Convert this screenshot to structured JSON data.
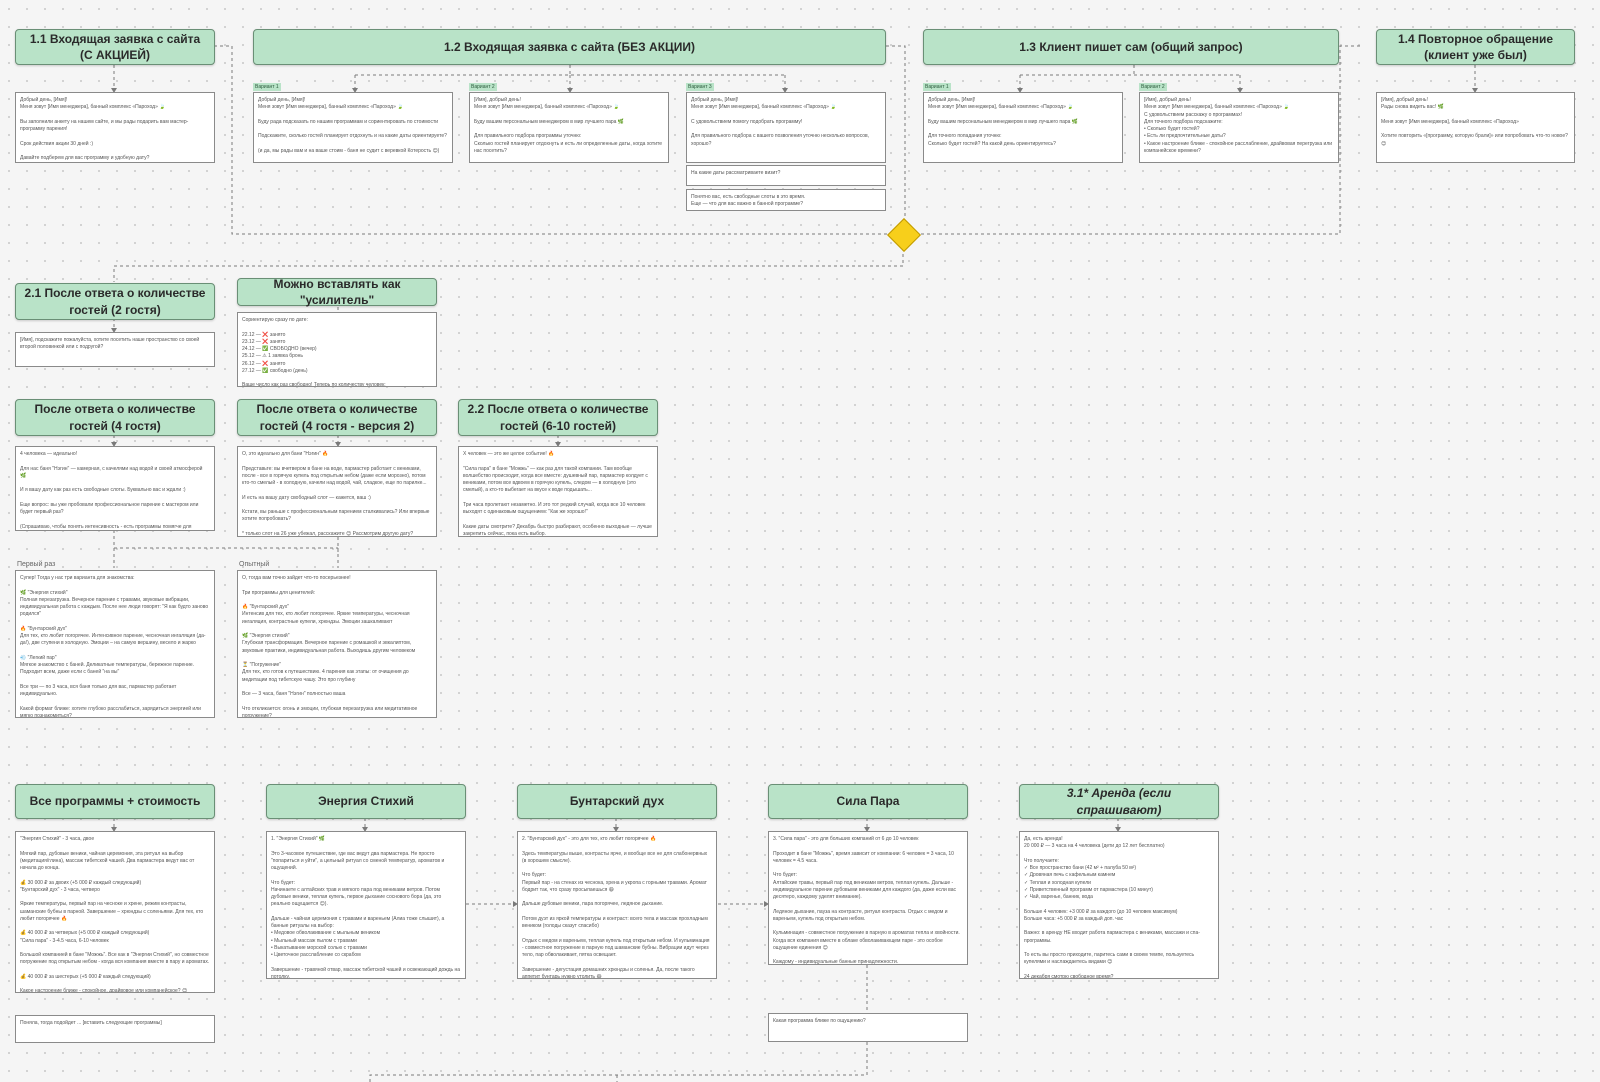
{
  "headers": {
    "h11": "1.1 Входящая заявка с сайта (С АКЦИЕЙ)",
    "h12": "1.2 Входящая заявка с сайта (БЕЗ АКЦИИ)",
    "h13": "1.3 Клиент пишет сам (общий запрос)",
    "h14": "1.4 Повторное обращение (клиент уже был)",
    "h21": "2.1 После ответа о количестве гостей (2 гостя)",
    "hAmp": "Можно вставлять как \"усилитель\"",
    "h4g": "После ответа о количестве гостей (4 гостя)",
    "h4g2": "После ответа о количестве гостей (4 гостя - версия 2)",
    "h22": "2.2 После ответа о количестве гостей (6-10 гостей)",
    "hAll": "Все программы + стоимость",
    "hEnergy": "Энергия Стихий",
    "hRebel": "Бунтарский дух",
    "hPower": "Сила Пара",
    "hRent": "3.1* Аренда (если спрашивают)"
  },
  "tags": {
    "v1": "Вариант 1",
    "v2": "Вариант 2",
    "v3": "Вариант 3"
  },
  "labels": {
    "first": "Первый раз",
    "experienced": "Опытный"
  },
  "notes": {
    "n11": "Добрый день, [Имя]!\nМеня зовут [Имя менеджера], банный комплекс «Пароход» 🍃\n\nВы заполнили анкету на нашем сайте, и мы рады подарить вам мастер-программу парения!\n\nСрок действия акции 30 дней :)\n\nДавайте подберем для вас программу и удобную дату?",
    "n12a": "Добрый день, [Имя]!\nМеня зовут [Имя менеджера], банный комплекс «Пароход» 🍃\n\nБуду рада подсказать по нашим программам и сориентировать по стоимости\n\nПодскажите, сколько гостей планирует отдохнуть и на какие даты ориентируете?\n\n(и да, мы рады вам и на ваше стоим - баня не судит с веревкой Котерость 😊)",
    "n12b": "[Имя], добрый день!\nМеня зовут [Имя менеджера], банный комплекс «Пароход» 🍃\n\nБуду вашим персональным менеджером в мир лучшего пара 🌿\n\nДля правильного подбора программы уточню:\nСколько гостей планирует отдохнуть и есть ли определенные даты, когда хотите нас посетить?",
    "n12c": "Добрый день, [Имя]!\nМеня зовут [Имя менеджера], банный комплекс «Пароход» 🍃\n\nС удовольствием помогу подобрать программу!\n\nДля правильного подбора с вашего позволения уточню несколько вопросов, хорошо?",
    "n12c2": "На какие даты рассматриваете визит?",
    "n12c3": "Понятно вас, есть свободные слоты в это время.\nЕще — что для вас важно в банной программе?",
    "n13a": "Добрый день, [Имя]!\nМеня зовут [Имя менеджера], банный комплекс «Пароход» 🍃\n\nБуду вашим персональным менеджером в мир лучшего пара 🌿\n\nДля точного попадания уточню:\nСколько будет гостей? На какой день ориентируетесь?",
    "n13b": "[Имя], добрый день!\nМеня зовут [Имя менеджера], банный комплекс «Пароход» 🍃\nС удовольствием расскажу о программах!\nДля точного подбора подскажите:\n•  Сколько будет гостей?\n•  Есть ли предпочтительные даты?\n•  Какое настроение ближе - спокойное расслабление, драйвовая перегрузка или компанейское времени?",
    "n14": "[Имя], добрый день!\nРады снова видеть вас! 🌿\n\nМеня зовут [Имя менеджера], банный комплекс «Пароход»\n\nХотите повторить «[программу, которую брали]» или попробовать что-то новое? 😊",
    "n21": "[Имя], подскажите пожалуйста, хотите посетить наше пространство со своей второй половинкой или с подругой?",
    "nAmp": "Сориентирую сразу по дате:\n\n22.12 — ❌ занято\n23.12 — ❌ занято\n24.12 — ✅ СВОБОДНО (вечер)\n25.12 — ⚠ 1 заявка бронь\n26.12 — ❌ занято\n27.12 — ✅ свободно (день)\n\nВаше число как раз свободно! Теперь по количеству человек:",
    "n4g": "4 человека — идеально!\n\nДля нас баня \"Нэгин\" — камерная, с качелями над водой и своей атмосферой 🌿\n\nИ я вашу дату как раз есть свободные слоты. Буквально вас и ждали :)\n\nЕще вопрос: вы уже пробовали профессиональное парение с мастером или будет первый раз?\n\n(Спрашиваю, чтобы понять интенсивность - есть программы помягче для знакомства, есть пожарче для опытных)",
    "n4g2": "О, это идеально для бани \"Нэгин\" 🔥\n\nПредставьте: вы вчетвером в бане на воде, пармастер работает с вениками, после - все в горячую купель под открытым небом (даже если морозно), потом кто-то смелый - в холодную, качели над водой, чай, сладкое, еще по парилке...\n\nИ есть на вашу дату свободный слот — кажется, ваш :)\n\nКстати, вы раньше с профессиональным парением сталкивались? Или впервые хотите попробовать?\n\n* только слот на 26 уже убежал, расскажите 😊 Рассмотрим другую дату?",
    "n22": "X человек — это же целое событие! 🔥\n\n\"Сила пара\" в бане \"Можжь\" — как раз для такой компании. Там вообще волшебство происходит, когда все вместе: душевный пар, пармастер колдует с вениками, потом все вдвоем в горячую купель, следом — в холодную (это смелый), а кто-то выбегает на вкусе к воде подышать...\n\nТри часа пролетают незаметно. И это тот редкий случай, когда все 10 человек выходят с одинаковым ощущением: \"Как же хорошо!\"\n\nКакие даты смотрите? Декабрь быстро разбирают, особенно выходные — лучше закрепить сейчас, пока есть выбор.",
    "nFirst": "Супер! Тогда у нас три варианта для знакомства:\n\n🌿 \"Энергия стихий\"\nПолная перезагрузка. Вечерное парение с травами, звуковые вибрации, индивидуальная работа с каждым. После нее люди говорят: \"Я как будто заново родился\"\n\n🔥 \"Бунтарский дух\"\nДля тех, кто любит погорячее. Интенсивное парение, чесночная ингаляция (да-да!), две ступени в холодную. Эмоции – на самую вершину, весело и жарко\n\n💨 \"Легкий пар\"\nМягкое знакомство с баней. Деликатные температуры, бережное парение. Подходит всем, даже если с баней \"на вы\"\n\nВсе три — по 3 часа, вся баня только для вас, пармастер работает индивидуально.\n\nКакой формат ближе: хотите глубоко расслабиться, зарядиться энергией или мягко познакомиться?",
    "nExp": "О, тогда вам точно зайдет что-то посерьезнее!\n\nТри программы для ценителей:\n\n🔥 \"Бунтарский дух\"\nИнтенсив для тех, кто любит погорячее. Яркие температуры, чесночная ингаляция, контрастные купели, хрюндзы. Эмоции зашкаливают\n\n🌿 \"Энергия стихий\"\nГлубокая трансформация. Вечерное парение с ромашкой и эвкалиптом, звуковые практики, индивидуальная работа. Выходишь другим человеком\n\n⏳ \"Погружение\"\nДля тех, кто готов к путешествию. 4 парения как этапы: от очищения до медитации под тибетскую чашу. Это про глубину\n\nВсе — 3 часа, баня \"Нэгин\" полностью ваша\n\nЧто откликается: огонь и эмоции, глубокая перезагрузка или медитативное погружение?",
    "nAll": "\"Энергия Стихий\" - 3 часа, двое\n\nМягкий пар, дубовые веники, чайная церемония, эта ритуал на выбор (медитация/глина), массаж тибетской чашей. Два пармастера ведут вас от начала до конца.\n\n💰 30 000 ₽ за двоих (+5 000 ₽ каждый следующий)\n\"Бунтарский дух\" - 3 часа, четверо\n\nЯркие температуры, первый пар на чесноке и хрене, режим контрасты, шаманские бубны в парной. Завершение – хрюндзы с соленьями. Для тех, кто любит погорячее 🔥\n\n💰 40 000 ₽ за четверых (+5 000 ₽ каждый следующий)\n\"Сила пара\" - 3-4.5 часа, 6-10 человек\n\nБольшой компанией в бане \"Можжь\". Все как в \"Энергии Стихий\", но совместное погружение под открытым небом - когда вся компания вместе в пару и ароматах.\n\n💰 40 000 ₽ за шестерых (+5 000 ₽ каждый следующий)\n\nКакое настроение ближе - спокойное, драйвовое или компанейское? 😊",
    "nAll2": "Поняла, тогда подойдет ... [вставить следующие программы]",
    "nEnergy": "1. \"Энергия Стихий\" 🌿\n\nЭто 3-часовое путешествие, где вас ведут два пармастера. Не просто \"попариться и уйти\", а цельный ритуал со сменой температур, ароматов и ощущений.\n\nЧто будет:\nНачинаете с алтайских трав и мягкого пара под вениками ветров. Потом дубовые веники, теплая купель, первое дыхание соснового бора (да, это реально ощущается 😊).\n\nДальше - чайная церемония с травами и вареньем (Алиа тоже слышит), а банные ритуалы на выбор:\n•  Медовое обволакивание с мыльным веником\n•  Мыльный массаж пылом с травами\n•  Выкатывание морской солью с травами\n•  Цветочное расслабление со скрабом\n\nЗавершение - травяной отвар, массаж тибетской чашей и освежающий дождь на потолку.",
    "nRebel": "2. \"Бунтарский дух\" - это для тех, кто любит погорячее 🔥\n\nЗдесь температуры выше, контрасты ярче, и вообще все не для слабонервных (в хорошем смысле).\n\nЧто будет:\nПервый пар - на стенах из чеснока, хрена и укропа с горными травами. Аромат бодрит так, что сразу просыпаешься 😄\n\nДальше дубовые веники, пара погорячее, ледяное дыхание.\n\nПотом дуэт из яркой температуры и контраст: всего тела и массаж прохладным веником (голоды сказут спасибо)\n\nОтдых с медом и вареньем, теплая купель под открытым небом. И кульминация - совместное погружение в парную под шаманские бубны. Вибрации идут через тело, пар обволакивает, пятка освещает.\n\nЗавершение - дегустация домашних хрюндзы и соленья. Да, после такого аппетит бунтарь нужно утолить 😄",
    "nPower": "3. \"Сила пара\" - это для больших компаний от 6 до 10 человек\n\nПроходит в бане \"Можжь\", время зависит от компании: 6 человек = 3 часа, 10 человек = 4.5 часа.\n\nЧто будет:\nАлтайские травы, первый пар под вениками ветров, теплая купель. Дальше - индивидуальное парение дубовыми вениками для каждого (да, даже если вас десятеро, каждому уделят внимание).\n\nЛедяное дыхание, пауза на контрасте, ритуал контраста. Отдых с медом и вареньем, купель под открытым небом.\n\nКульминация - совместное погружение в парную в ароматах тепла и хвойности. Когда вся компания вместе в облаке обволакивающем паре - это особое ощущение единения 😊\n\nКаждому - индивидуальные банные принадлежности.",
    "nPower2": "Какая программа ближе по ощущению?",
    "nRent": "Да, есть аренда!\n20 000 ₽ — 3 часа на 4 человека (дети до 12 лет бесплатно)\n\nЧто получаете:\n✓ Все пространство бани (42 м² + палуба 50 м²)\n✓ Дровяная печь с кафельным камнем\n✓ Теплая и холодная купели\n✓ Приветственный программ от пармастера (10 минут)\n✓ Чай, варенье, банник, вода\n\nБольше 4 человек: +3 000 ₽ за каждого (до 10 человек максимум)\nБольше часа: +5 000 ₽ за каждый доп. час\n\nВажно: в аренду НЕ входит работа пармастера с вениками, массажи и спа-программы.\n\nТо есть вы просто приходите, паритесь сами в своем темпе, пользуетесь купелями и наслаждаетесь видами 😊\n\n24 декабря смотрю свободное время?"
  },
  "colors": {
    "header_fill": "#b9e3c8",
    "decision": "#f7cf1b"
  }
}
